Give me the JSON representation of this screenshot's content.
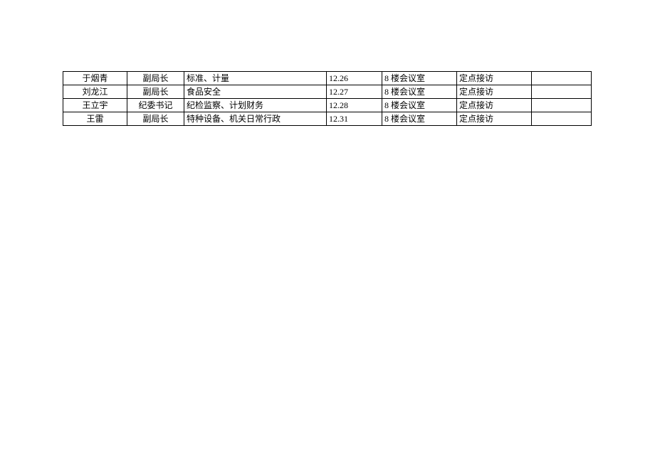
{
  "schedule": {
    "rows": [
      {
        "name": "于烟青",
        "title": "副局长",
        "duty": "标准、计量",
        "date": "12.26",
        "location": "8 楼会议室",
        "type": "定点接访",
        "blank": ""
      },
      {
        "name": "刘龙江",
        "title": "副局长",
        "duty": "食品安全",
        "date": "12.27",
        "location": "8 楼会议室",
        "type": "定点接访",
        "blank": ""
      },
      {
        "name": "王立宇",
        "title": "纪委书记",
        "duty": "纪检监察、计划财务",
        "date": "12.28",
        "location": "8 楼会议室",
        "type": "定点接访",
        "blank": ""
      },
      {
        "name": "王雷",
        "title": "副局长",
        "duty": "特种设备、机关日常行政",
        "date": "12.31",
        "location": "8 楼会议室",
        "type": "定点接访",
        "blank": ""
      }
    ]
  }
}
